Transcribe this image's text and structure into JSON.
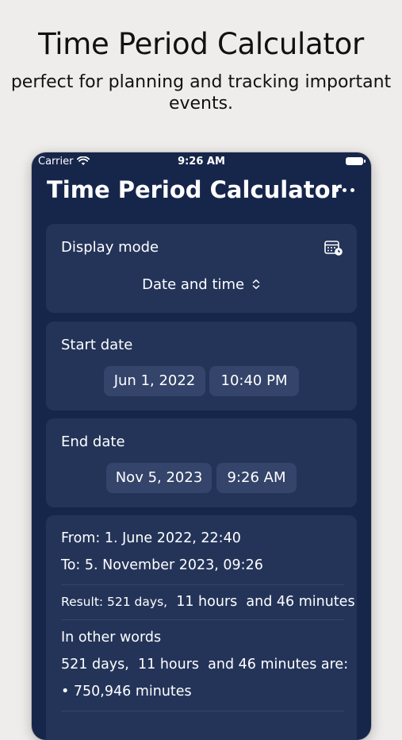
{
  "promo": {
    "title": "Time Period Calculator",
    "subtitle_line1": "perfect for planning and tracking important",
    "subtitle_line2": "events."
  },
  "status_bar": {
    "carrier": "Carrier",
    "time": "9:26 AM"
  },
  "nav": {
    "title": "Time Period Calculator",
    "more_icon": "ellipsis-icon"
  },
  "display_mode": {
    "label": "Display mode",
    "value": "Date and time",
    "icon": "calendar-clock-icon"
  },
  "start_date": {
    "label": "Start date",
    "date": "Jun 1, 2022",
    "time": "10:40 PM"
  },
  "end_date": {
    "label": "End date",
    "date": "Nov 5, 2023",
    "time": "9:26 AM"
  },
  "result": {
    "from": "From: 1. June 2022, 22:40",
    "to": "To: 5. November 2023, 09:26",
    "result_prefix": "Result: 521 days,",
    "result_hours": "11 hours",
    "result_minutes": "and 46 minutes",
    "other_words_label": "In other words",
    "summary_days": "521 days,",
    "summary_hours": "11 hours",
    "summary_rest": "and 46 minutes are:",
    "minutes_item": "• 750,946 minutes"
  },
  "colors": {
    "background": "#efedeb",
    "phone": "#16264b",
    "card": "#243459",
    "pill": "#34446a"
  }
}
